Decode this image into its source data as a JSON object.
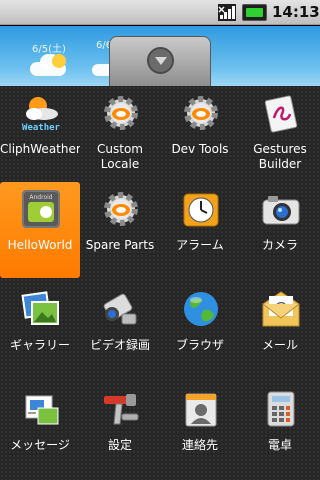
{
  "status_bar": {
    "time": "14:13",
    "icons": [
      "signal-icon",
      "battery-icon"
    ]
  },
  "wallpaper": {
    "dates": [
      "6/5(土)",
      "6/6"
    ]
  },
  "drawer_handle": {
    "icon": "chevron-down-icon"
  },
  "apps": [
    {
      "label": "CliphWeather",
      "icon": "weather-icon",
      "selected": false
    },
    {
      "label": "Custom Locale",
      "icon": "gear-icon",
      "selected": false
    },
    {
      "label": "Dev Tools",
      "icon": "gear-icon",
      "selected": false
    },
    {
      "label": "Gestures Builder",
      "icon": "gestures-icon",
      "selected": false
    },
    {
      "label": "HelloWorld",
      "icon": "android-icon",
      "selected": true
    },
    {
      "label": "Spare Parts",
      "icon": "gear-icon",
      "selected": false
    },
    {
      "label": "アラーム",
      "icon": "clock-icon",
      "selected": false
    },
    {
      "label": "カメラ",
      "icon": "camera-icon",
      "selected": false
    },
    {
      "label": "ギャラリー",
      "icon": "gallery-icon",
      "selected": false
    },
    {
      "label": "ビデオ録画",
      "icon": "video-camera-icon",
      "selected": false
    },
    {
      "label": "ブラウザ",
      "icon": "globe-icon",
      "selected": false
    },
    {
      "label": "メール",
      "icon": "mail-icon",
      "selected": false
    },
    {
      "label": "メッセージ",
      "icon": "message-icon",
      "selected": false
    },
    {
      "label": "設定",
      "icon": "settings-icon",
      "selected": false
    },
    {
      "label": "連絡先",
      "icon": "contacts-icon",
      "selected": false
    },
    {
      "label": "電卓",
      "icon": "calculator-icon",
      "selected": false
    }
  ],
  "weather_icon_text": "Weather",
  "android_icon_text": "Android"
}
